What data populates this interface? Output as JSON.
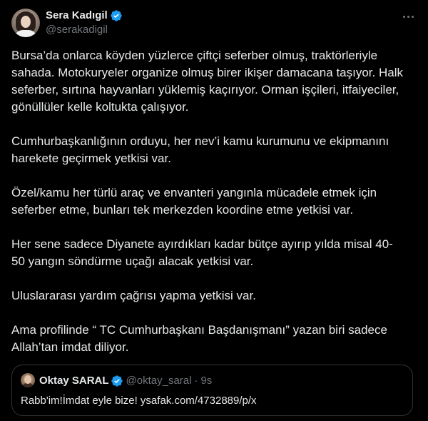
{
  "author": {
    "display_name": "Sera Kadıgil",
    "handle": "@serakadigil",
    "verified": true,
    "avatar_icon": "profile-photo"
  },
  "more_icon": "ellipsis-icon",
  "tweet_paragraphs": [
    "Bursa’da onlarca köyden yüzlerce çiftçi seferber olmuş, traktörleriyle\nsahada. Motokuryeler organize olmuş birer ikişer damacana taşıyor. Halk\nseferber, sırtına hayvanları yüklemiş kaçırıyor. Orman işçileri, itfaiyeciler,\ngönüllüler kelle koltukta çalışıyor.",
    "Cumhurbaşkanlığının orduyu, her nev’i kamu kurumunu ve ekipmanını\nharekete geçirmek yetkisi var.",
    "Özel/kamu her türlü araç ve envanteri yangınla mücadele etmek için\nseferber etme, bunları tek merkezden koordine etme yetkisi var.",
    "Her sene sadece Diyanete ayırdıkları kadar bütçe ayırıp yılda misal 40-\n50 yangın söndürme uçağı alacak yetkisi var.",
    "Uluslararası yardım çağrısı yapma yetkisi var.",
    "Ama profilinde “ TC Cumhurbaşkanı Başdanışmanı” yazan biri sadece\nAllah’tan imdat diliyor."
  ],
  "quoted_tweet": {
    "display_name": "Oktay SARAL",
    "handle": "@oktay_saral",
    "separator": "·",
    "time": "9s",
    "verified": true,
    "text": "Rabb'im!İmdat eyle bize! ysafak.com/4732889/p/x"
  },
  "colors": {
    "background": "#000000",
    "text": "#e7e9ea",
    "secondary_text": "#71767b",
    "border": "#2f3336",
    "verified_blue": "#1d9bf0"
  }
}
